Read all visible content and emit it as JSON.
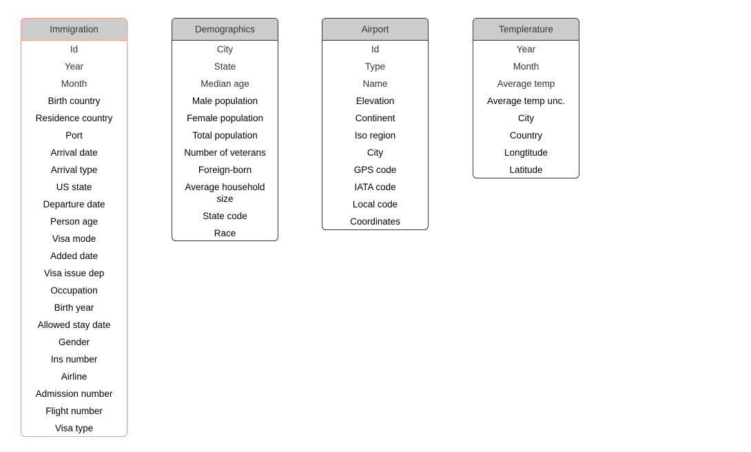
{
  "colors": {
    "header_bg": "#cccccc",
    "border": "#333333",
    "selected_border": "#f5958a"
  },
  "entities": [
    {
      "id": "immigration",
      "title": "Immigration",
      "selected": true,
      "fields": [
        "Id",
        "Year",
        "Month",
        "Birth country",
        "Residence country",
        "Port",
        "Arrival date",
        "Arrival type",
        "US state",
        "Departure date",
        "Person age",
        "Visa mode",
        "Added date",
        "Visa issue dep",
        "Occupation",
        "Birth year",
        "Allowed stay date",
        "Gender",
        "Ins number",
        "Airline",
        "Admission number",
        "Flight number",
        "Visa type"
      ]
    },
    {
      "id": "demographics",
      "title": "Demographics",
      "selected": false,
      "fields": [
        "City",
        "State",
        "Median age",
        "Male population",
        "Female population",
        "Total population",
        "Number of veterans",
        "Foreign-born",
        "Average household size",
        "State code",
        "Race"
      ]
    },
    {
      "id": "airport",
      "title": "Airport",
      "selected": false,
      "fields": [
        "Id",
        "Type",
        "Name",
        "Elevation",
        "Continent",
        "Iso region",
        "City",
        "GPS code",
        "IATA code",
        "Local code",
        "Coordinates"
      ]
    },
    {
      "id": "temperature",
      "title": "Templerature",
      "selected": false,
      "fields": [
        "Year",
        "Month",
        "Average temp",
        "Average temp unc.",
        "City",
        "Country",
        "Longtitude",
        "Latitude"
      ]
    }
  ]
}
